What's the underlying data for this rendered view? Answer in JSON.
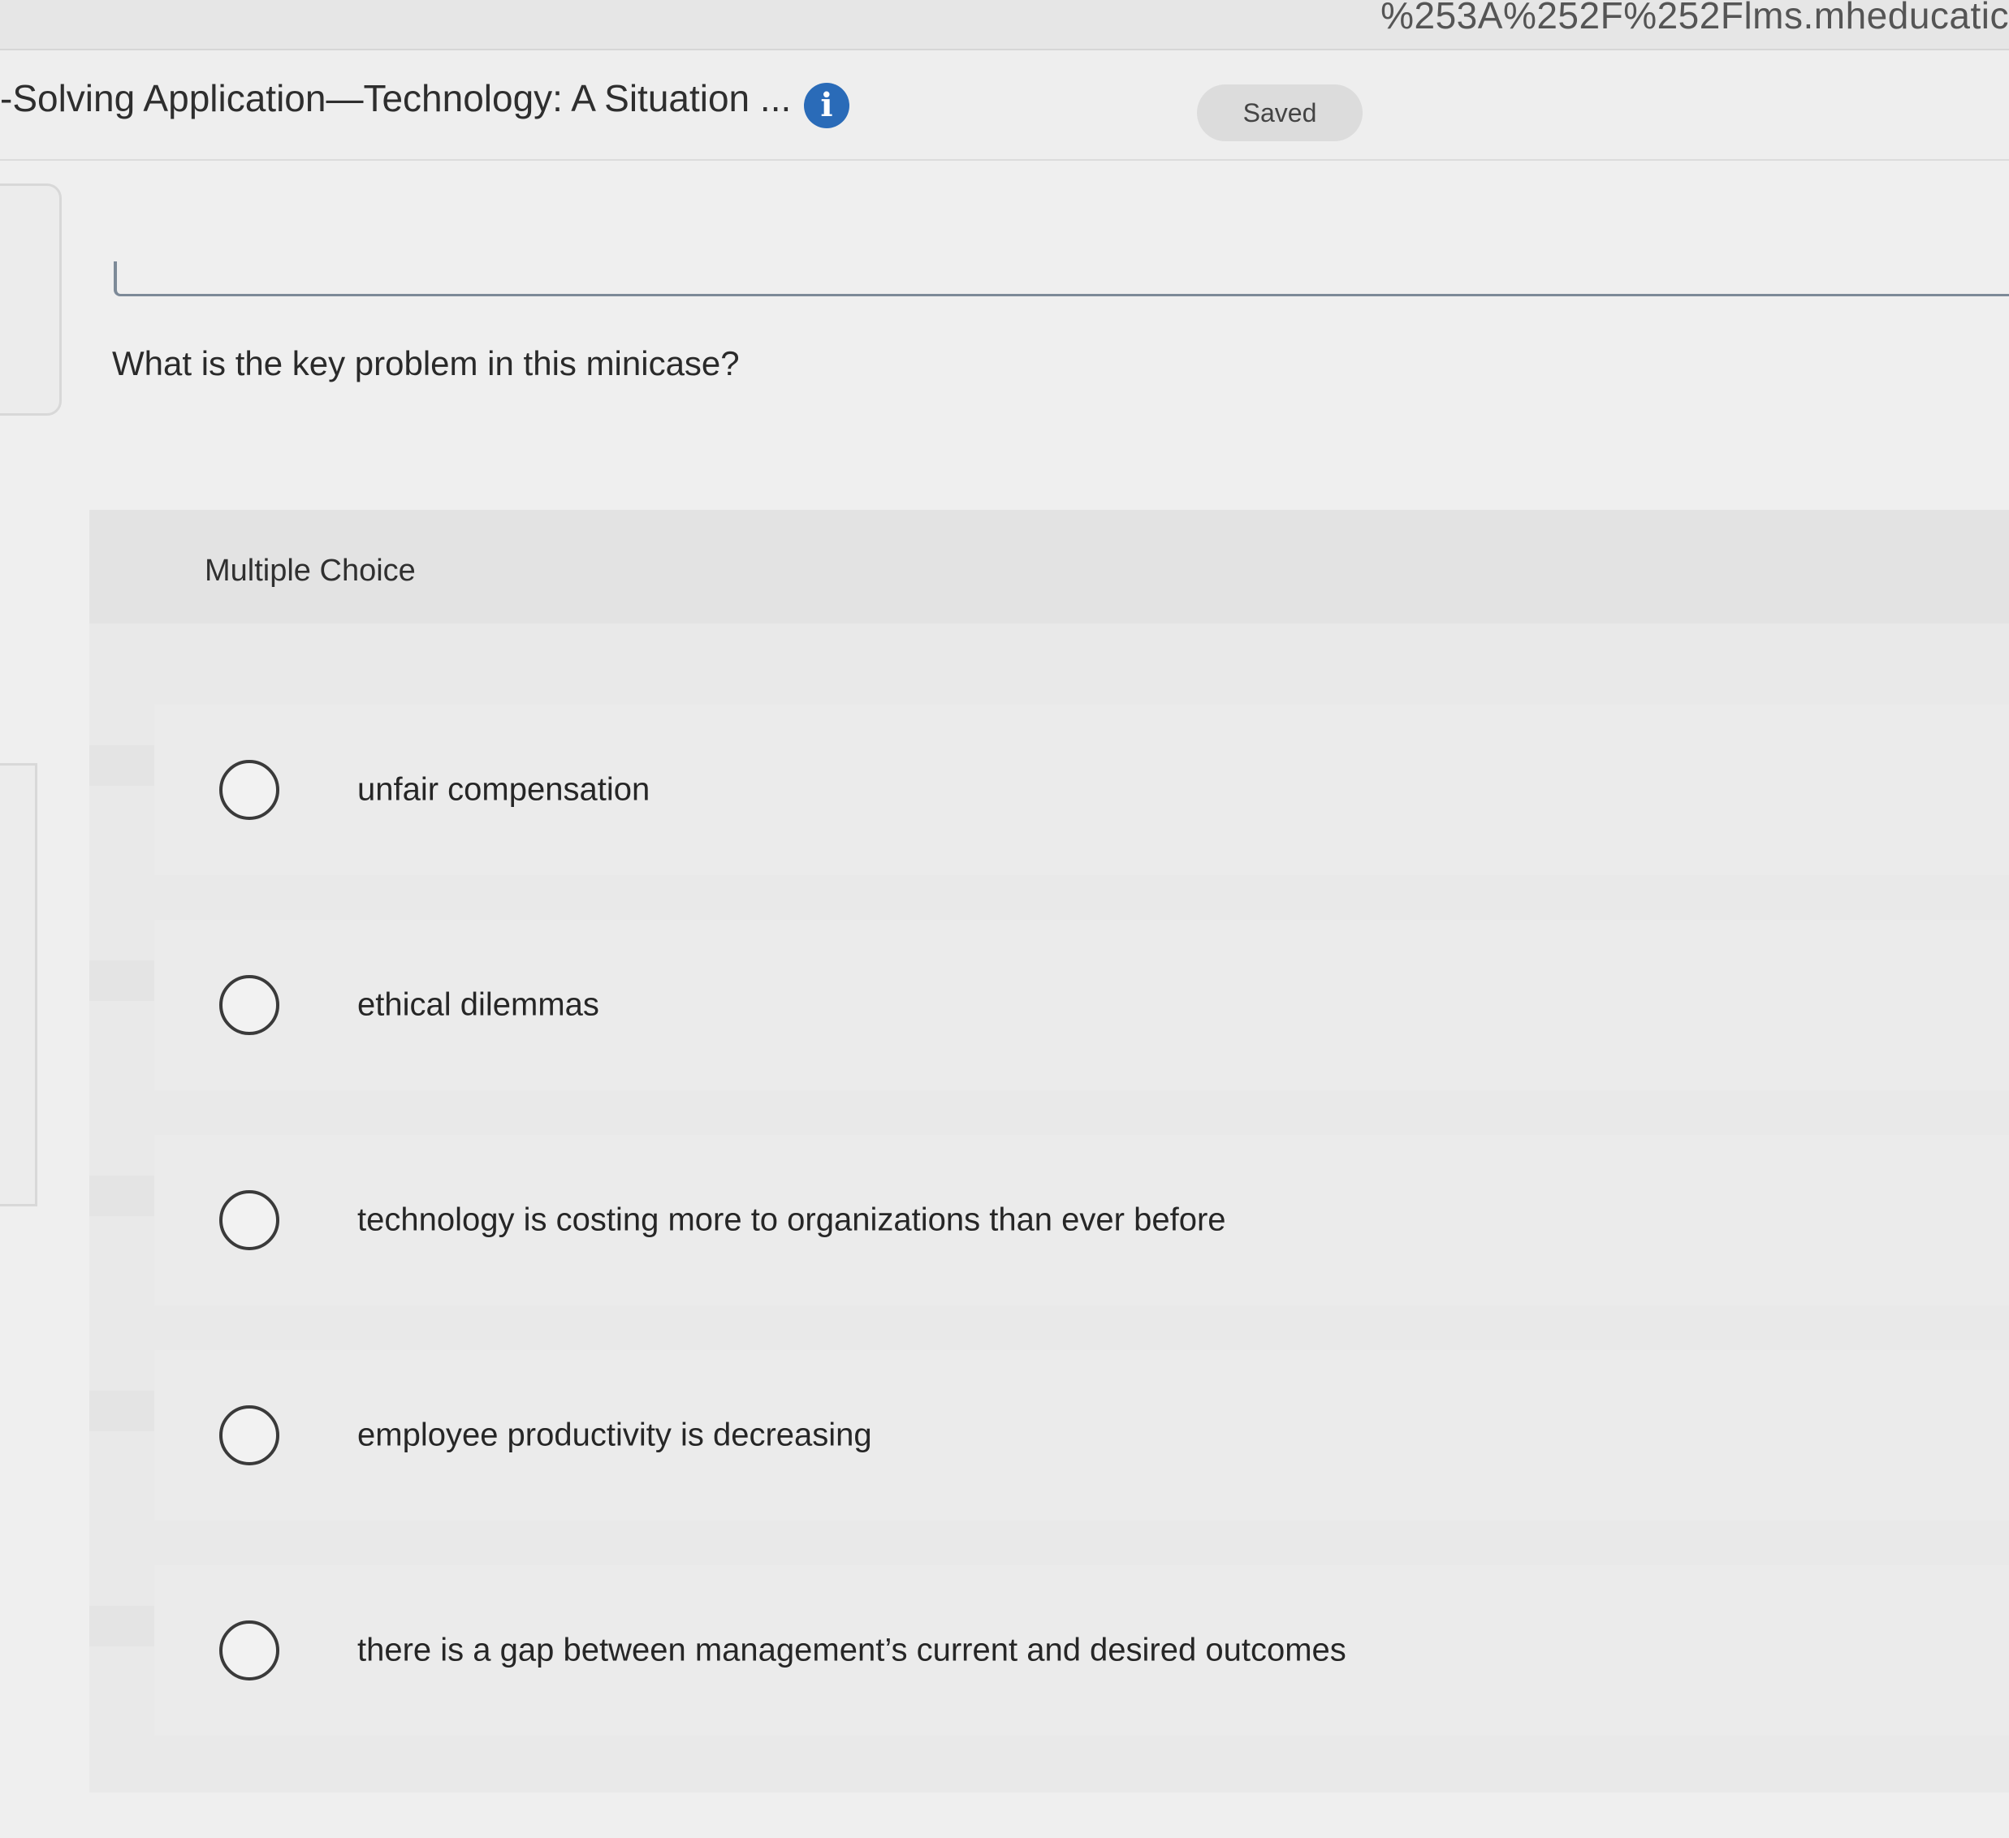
{
  "browser": {
    "url_fragment": "%253A%252F%252Flms.mheducatic"
  },
  "header": {
    "title": "-Solving Application—Technology: A Situation ...",
    "info_icon": "info-icon",
    "saved_label": "Saved"
  },
  "question": {
    "text": "What is the key problem in this minicase?"
  },
  "multiple_choice": {
    "label": "Multiple Choice",
    "options": [
      {
        "text": "unfair compensation",
        "selected": false
      },
      {
        "text": "ethical dilemmas",
        "selected": false
      },
      {
        "text": "technology is costing more to organizations than ever before",
        "selected": false
      },
      {
        "text": "employee productivity is decreasing",
        "selected": false
      },
      {
        "text": "there is a gap between management’s current and desired outcomes",
        "selected": false
      }
    ]
  },
  "colors": {
    "info_icon": "#2a6bb8",
    "background": "#efefef",
    "divider": "#7d8a98"
  }
}
